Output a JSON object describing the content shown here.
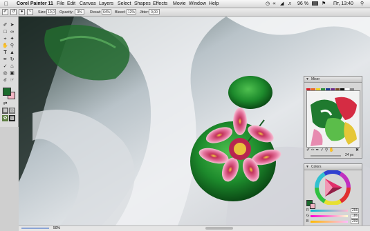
{
  "menubar": {
    "apple": "",
    "app_name": "Corel Painter 11",
    "menus": [
      "File",
      "Edit",
      "Canvas",
      "Layers",
      "Select",
      "Shapes",
      "Effects",
      "Movie",
      "Window",
      "Help"
    ],
    "battery": "96 %",
    "clock": "Пт, 13:40"
  },
  "propbar": {
    "size_label": "Size:",
    "size_value": "10,0",
    "opacity_label": "Opacity:",
    "opacity_value": "3%",
    "resat_label": "Resat:",
    "resat_value": "64%",
    "bleed_label": "Bleed:",
    "bleed_value": "12%",
    "jitter_label": "Jitter:",
    "jitter_value": "0,00"
  },
  "colors": {
    "main_color": "#1b6b2d",
    "additional_color": "#f3b6c5"
  },
  "mixer_panel": {
    "title": "Mixer",
    "brush_size": "24 px"
  },
  "colors_panel": {
    "title": "Colors",
    "r_label": "R",
    "g_label": "G",
    "b_label": "B",
    "r_value": "255",
    "g_value": "186",
    "b_value": "209"
  },
  "status": {
    "zoom": "50%"
  }
}
